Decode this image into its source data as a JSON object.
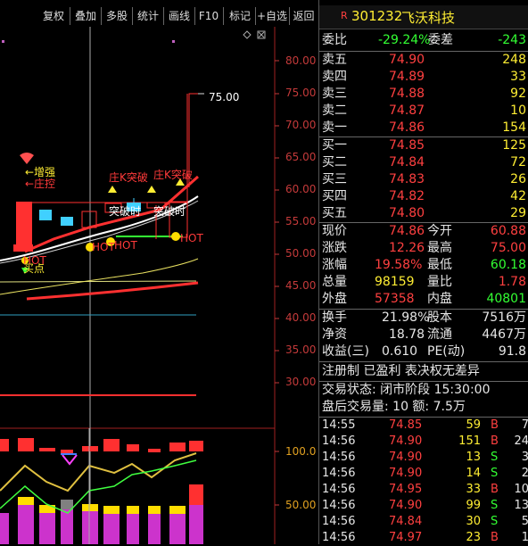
{
  "toolbar": {
    "buttons": [
      "复权",
      "叠加",
      "多股",
      "统计",
      "画线",
      "F10",
      "标记",
      "+自选",
      "返回"
    ]
  },
  "chart": {
    "price_axis": [
      "80.00",
      "75.00",
      "70.00",
      "65.00",
      "60.00",
      "55.00",
      "50.00",
      "45.00",
      "40.00",
      "35.00",
      "30.00"
    ],
    "vol_axis": [
      "100.0",
      "50.00"
    ],
    "annotations": {
      "price_tag": "75.00",
      "zengqiang": "←增强",
      "zhuangkong": "←庄控",
      "zhuangK_tupo1": "庄K突破",
      "zhuangK_tupo2": "庄K突破",
      "tupo_white1": "突破时",
      "tupo_white2": "突破时",
      "hot1": "HOT",
      "hot2": "HOT",
      "hot3": "HOT",
      "hot4": "HOT",
      "maidian": "买点"
    }
  },
  "stock": {
    "code": "301232",
    "name": "飞沃科技",
    "badge": "R"
  },
  "quote": {
    "weibi_label": "委比",
    "weibi_value": "-29.24%",
    "weicha_label": "委差",
    "weicha_value": "-243",
    "asks": [
      {
        "label": "卖五",
        "price": "74.90",
        "vol": "248"
      },
      {
        "label": "卖四",
        "price": "74.89",
        "vol": "33"
      },
      {
        "label": "卖三",
        "price": "74.88",
        "vol": "92"
      },
      {
        "label": "卖二",
        "price": "74.87",
        "vol": "10"
      },
      {
        "label": "卖一",
        "price": "74.86",
        "vol": "154"
      }
    ],
    "bids": [
      {
        "label": "买一",
        "price": "74.85",
        "vol": "125"
      },
      {
        "label": "买二",
        "price": "74.84",
        "vol": "72"
      },
      {
        "label": "买三",
        "price": "74.83",
        "vol": "26"
      },
      {
        "label": "买四",
        "price": "74.82",
        "vol": "42"
      },
      {
        "label": "买五",
        "price": "74.80",
        "vol": "29"
      }
    ],
    "stats": [
      {
        "l1": "现价",
        "v1": "74.86",
        "l2": "今开",
        "v2": "60.88"
      },
      {
        "l1": "涨跌",
        "v1": "12.26",
        "l2": "最高",
        "v2": "75.00"
      },
      {
        "l1": "涨幅",
        "v1": "19.58%",
        "l2": "最低",
        "v2": "60.18"
      },
      {
        "l1": "总量",
        "v1": "98159",
        "l2": "量比",
        "v2": "1.78"
      },
      {
        "l1": "外盘",
        "v1": "57358",
        "l2": "内盘",
        "v2": "40801"
      }
    ],
    "stats2": [
      {
        "l1": "换手",
        "v1": "21.98%",
        "l2": "股本",
        "v2": "7516万"
      },
      {
        "l1": "净资",
        "v1": "18.78",
        "l2": "流通",
        "v2": "4467万"
      },
      {
        "l1": "收益(三)",
        "v1": "0.610",
        "l2": "PE(动)",
        "v2": "91.8"
      }
    ],
    "notice": "注册制 已盈利 表决权无差异",
    "trade_state": "交易状态: 闭市阶段 15:30:00",
    "after_hours": "盘后交易量: 10  额: 7.5万"
  },
  "ticks": [
    {
      "time": "14:55",
      "price": "74.85",
      "vol": "59",
      "dir": "B",
      "n": "7"
    },
    {
      "time": "14:56",
      "price": "74.90",
      "vol": "151",
      "dir": "B",
      "n": "24"
    },
    {
      "time": "14:56",
      "price": "74.90",
      "vol": "13",
      "dir": "S",
      "n": "3"
    },
    {
      "time": "14:56",
      "price": "74.90",
      "vol": "14",
      "dir": "S",
      "n": "2"
    },
    {
      "time": "14:56",
      "price": "74.95",
      "vol": "33",
      "dir": "B",
      "n": "10"
    },
    {
      "time": "14:56",
      "price": "74.90",
      "vol": "99",
      "dir": "S",
      "n": "13"
    },
    {
      "time": "14:56",
      "price": "74.84",
      "vol": "30",
      "dir": "S",
      "n": "5"
    },
    {
      "time": "14:56",
      "price": "74.97",
      "vol": "23",
      "dir": "B",
      "n": "1"
    }
  ],
  "colors": {
    "up": "#ff4040",
    "down": "#33ff33",
    "label": "#e6e6e6",
    "axis": "#c43a3a"
  }
}
